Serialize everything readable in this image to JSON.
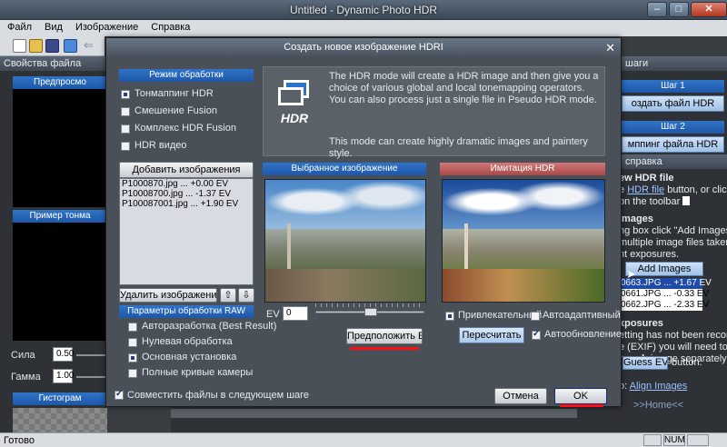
{
  "window": {
    "title": "Untitled - Dynamic Photo HDR",
    "buttons": [
      "–",
      "□",
      "✕"
    ]
  },
  "menu": [
    "Файл",
    "Вид",
    "Изображение",
    "Справка"
  ],
  "left_panel": {
    "header": "Свойства файла",
    "preview_label": "Предпросмо",
    "tonemap_label": "Пример тонма",
    "strength_label": "Сила",
    "strength_value": "0.50",
    "gamma_label": "Гамма",
    "gamma_value": "1.00",
    "histogram_label": "Гистограм"
  },
  "right_panel": {
    "header": "шаги",
    "step1_label": "Шаг 1",
    "step1_button": "оздать файл HDR",
    "step2_label": "Шаг 2",
    "step2_button": "мппинг файла HDR",
    "help_header": "справка",
    "help_line1": "ew HDR file",
    "help_line2a": "e ",
    "help_line2_link": "HDR file",
    "help_line2b": " button, or click",
    "help_line3": "on the toolbar",
    "images_title": "images",
    "images_line1": "ng box click \"Add Images\"",
    "images_line2": "multiple image files taken",
    "images_line3": "nt exposures.",
    "add_images_button": "Add Images",
    "ev_list": [
      "0663.JPG ... +1.67 EV",
      "0661.JPG ... -0.33 EV",
      "0662.JPG ... -2.33 EV"
    ],
    "exposures_title": "xposures",
    "exp_line1": "etting has not been recorded",
    "exp_line2": "e (EXIF) you will need to",
    "exp_line3a": "r ",
    "exp_line3_bold": "each",
    "exp_line3b": " image separately",
    "exp_line4": "button.",
    "guess_ev_button": "Guess EV",
    "align_prefix": "o:",
    "align_link": "Align Images",
    "home_link": ">>Home<<"
  },
  "status": {
    "text": "Готово",
    "num": "NUM"
  },
  "dialog": {
    "title": "Создать новое изображение HDRI",
    "close": "✕",
    "mode_header": "Режим обработки",
    "modes": [
      {
        "label": "Тонмаппинг HDR",
        "selected": true
      },
      {
        "label": "Смешение Fusion",
        "selected": false
      },
      {
        "label": "Комплекс HDR Fusion",
        "selected": false
      },
      {
        "label": "HDR видео",
        "selected": false
      }
    ],
    "info_logo": "HDR",
    "info_text1": "The HDR mode will create a HDR image and then give you a choice of various global and local tonemapping operators. You can also process just a single file in Pseudo HDR mode.",
    "info_text2": "This mode can create highly dramatic images and paintery style.",
    "add_images_button": "Добавить изображения",
    "files": [
      "P1000870.jpg ... +0.00 EV",
      "P10008700.jpg ... -1.37 EV",
      "P100087001.jpg ... +1.90 EV"
    ],
    "remove_button": "Удалить изображение",
    "raw_header": "Параметры обработки RAW",
    "raw_options": [
      {
        "label": "Авторазработка (Best Result)",
        "selected": false
      },
      {
        "label": "Нулевая обработка",
        "selected": false
      },
      {
        "label": "Основная установка",
        "selected": true
      },
      {
        "label": "Полные кривые камеры",
        "selected": false
      }
    ],
    "selected_image_header": "Выбранное изображение",
    "hdr_imitation_header": "Имитация HDR",
    "ev_label": "EV",
    "ev_value": "0",
    "guess_ev_button": "Предположить EV",
    "attractive_label": "Привлекательный",
    "autoadaptive_label": "Автоадаптивный",
    "recalc_button": "Пересчитать",
    "autoupdate_label": "Автообновление",
    "align_label": "Совместить файлы в следующем шаге",
    "cancel_button": "Отмена",
    "ok_button": "OK"
  }
}
